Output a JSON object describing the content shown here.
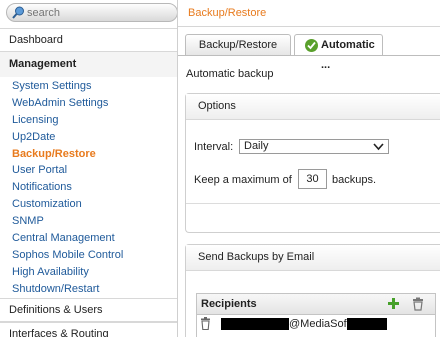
{
  "search": {
    "placeholder": "search"
  },
  "sidebar": {
    "dashboard": "Dashboard",
    "management_header": "Management",
    "management_items": [
      "System Settings",
      "WebAdmin Settings",
      "Licensing",
      "Up2Date",
      "Backup/Restore",
      "User Portal",
      "Notifications",
      "Customization",
      "SNMP",
      "Central Management",
      "Sophos Mobile Control",
      "High Availability",
      "Shutdown/Restart"
    ],
    "active_item": "Backup/Restore",
    "definitions": "Definitions & Users",
    "interfaces": "Interfaces & Routing"
  },
  "breadcrumb": "Backup/Restore",
  "tabs": {
    "backup_restore": "Backup/Restore",
    "automatic": "Automatic ..."
  },
  "section_title": "Automatic backup",
  "options": {
    "header": "Options",
    "interval_label": "Interval:",
    "interval_value": "Daily",
    "keep_prefix": "Keep a maximum of",
    "keep_value": "30",
    "keep_suffix": "backups."
  },
  "email": {
    "header": "Send Backups by Email",
    "recipients_header": "Recipients",
    "recipient_visible": "@MediaSof"
  },
  "colors": {
    "accent_orange": "#e87b1e",
    "link_blue": "#1f5a9a",
    "success_green": "#5aa02c"
  }
}
